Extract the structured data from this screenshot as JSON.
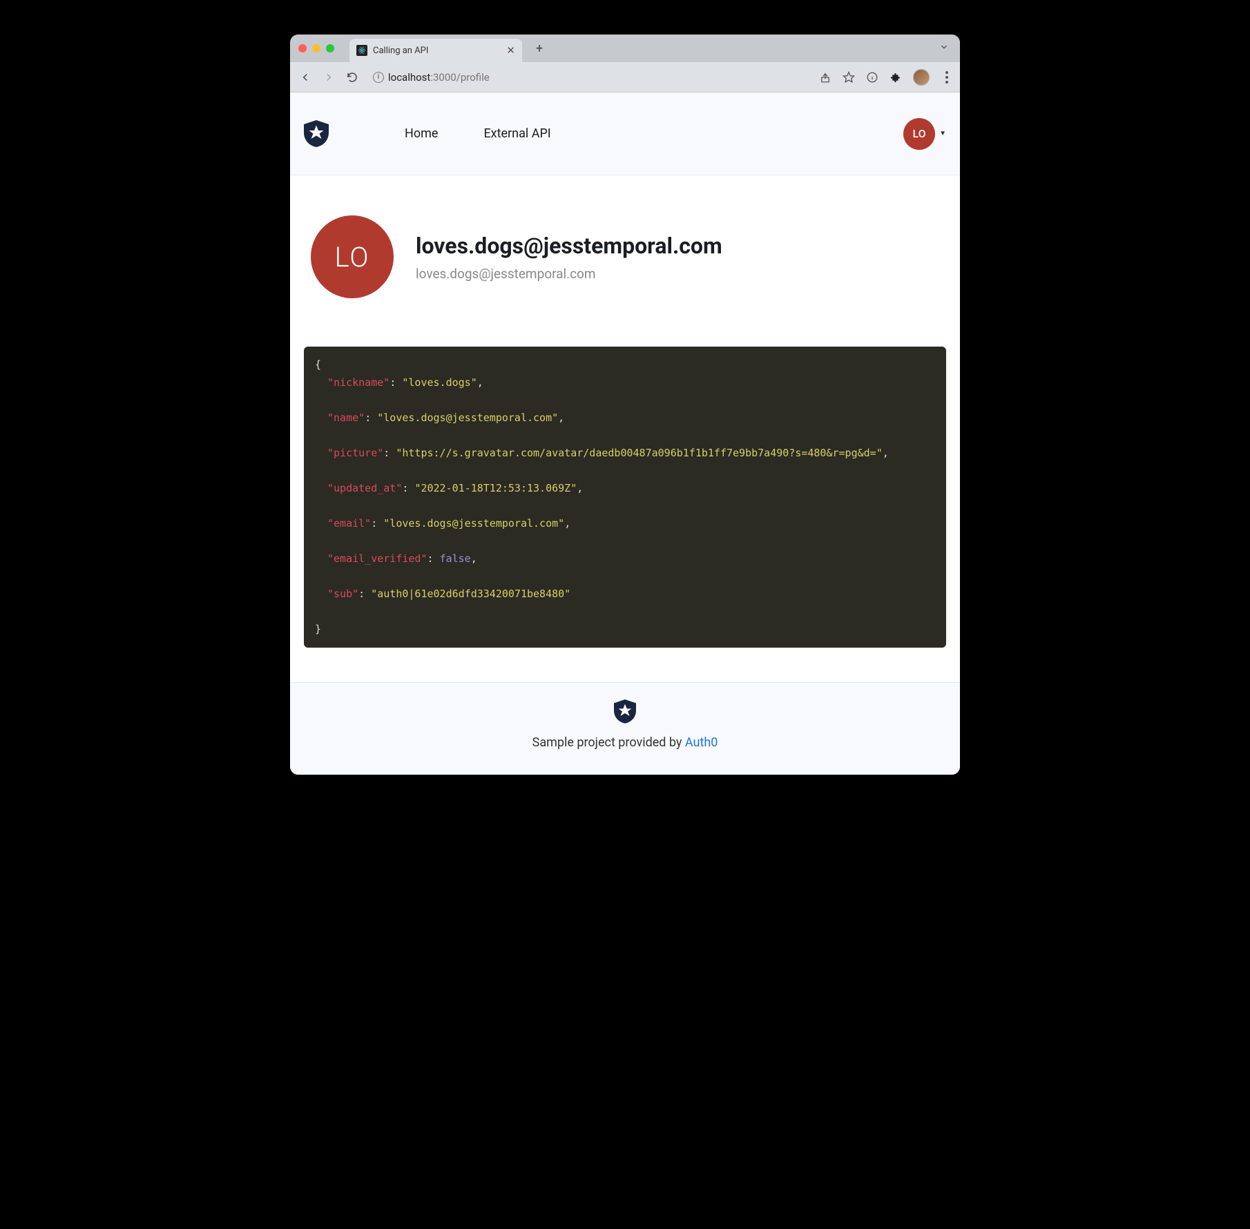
{
  "browser": {
    "tab_title": "Calling an API",
    "url_host": "localhost",
    "url_path": ":3000/profile"
  },
  "nav": {
    "links": [
      "Home",
      "External API"
    ],
    "avatar_initials": "LO"
  },
  "profile": {
    "avatar_initials": "LO",
    "title": "loves.dogs@jesstemporal.com",
    "subtitle": "loves.dogs@jesstemporal.com"
  },
  "json_view": {
    "entries": [
      {
        "key": "nickname",
        "value": "loves.dogs",
        "type": "string",
        "comma": true
      },
      {
        "key": "name",
        "value": "loves.dogs@jesstemporal.com",
        "type": "string",
        "comma": true
      },
      {
        "key": "picture",
        "value": "https://s.gravatar.com/avatar/daedb00487a096b1f1b1ff7e9bb7a490?s=480&r=pg&d=",
        "type": "string",
        "comma": true
      },
      {
        "key": "updated_at",
        "value": "2022-01-18T12:53:13.069Z",
        "type": "string",
        "comma": true
      },
      {
        "key": "email",
        "value": "loves.dogs@jesstemporal.com",
        "type": "string",
        "comma": true
      },
      {
        "key": "email_verified",
        "value": "false",
        "type": "bool",
        "comma": true
      },
      {
        "key": "sub",
        "value": "auth0|61e02d6dfd33420071be8480",
        "type": "string",
        "comma": false
      }
    ]
  },
  "footer": {
    "text": "Sample project provided by ",
    "link_text": "Auth0"
  }
}
